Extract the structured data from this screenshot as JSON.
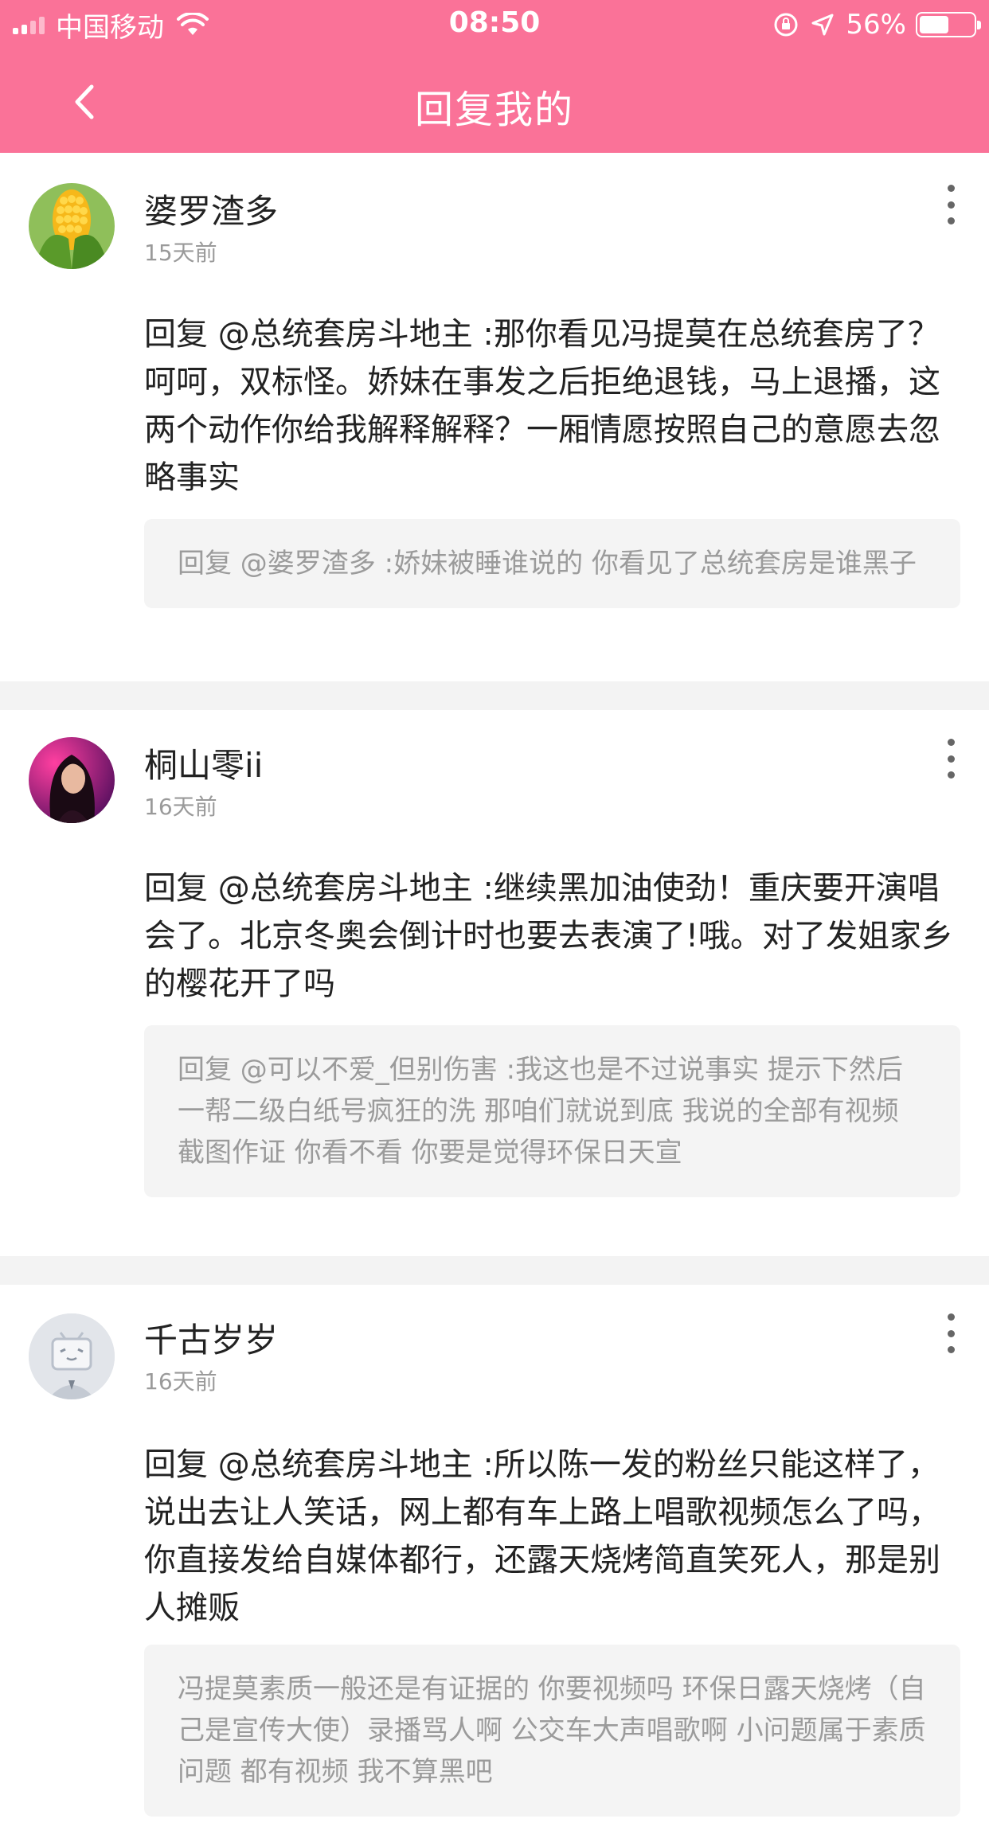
{
  "status_bar": {
    "carrier": "中国移动",
    "time": "08:50",
    "battery_percent": "56%",
    "battery_level": 0.56
  },
  "nav": {
    "title": "回复我的"
  },
  "colors": {
    "header_bg": "#fa7298",
    "divider": "#f3f3f3",
    "quote_bg": "#f4f4f4"
  },
  "replies": [
    {
      "username": "婆罗渣多",
      "time": "15天前",
      "avatar_icon": "corn-avatar",
      "content": "回复 @总统套房斗地主 :那你看见冯提莫在总统套房了？呵呵，双标怪。娇妹在事发之后拒绝退钱，马上退播，这两个动作你给我解释解释？一厢情愿按照自己的意愿去忽略事实",
      "quote": "回复 @婆罗渣多 :娇妹被睡谁说的 你看见了总统套房是谁黑子"
    },
    {
      "username": "桐山零ii",
      "time": "16天前",
      "avatar_icon": "girl-portrait-avatar",
      "content": "回复 @总统套房斗地主 :继续黑加油使劲！重庆要开演唱会了。北京冬奥会倒计时也要去表演了!哦。对了发姐家乡的樱花开了吗",
      "quote": "回复 @可以不爱_但别伤害 :我这也是不过说事实 提示下然后一帮二级白纸号疯狂的洗 那咱们就说到底 我说的全部有视频 截图作证 你看不看 你要是觉得环保日天宣"
    },
    {
      "username": "千古岁岁",
      "time": "16天前",
      "avatar_icon": "tv-mascot-avatar",
      "content": "回复 @总统套房斗地主 :所以陈一发的粉丝只能这样了，说出去让人笑话，网上都有车上路上唱歌视频怎么了吗，你直接发给自媒体都行，还露天烧烤简直笑死人，那是别人摊贩",
      "quote": "冯提莫素质一般还是有证据的 你要视频吗 环保日露天烧烤（自己是宣传大使）录播骂人啊 公交车大声唱歌啊 小问题属于素质问题 都有视频 我不算黑吧"
    }
  ]
}
